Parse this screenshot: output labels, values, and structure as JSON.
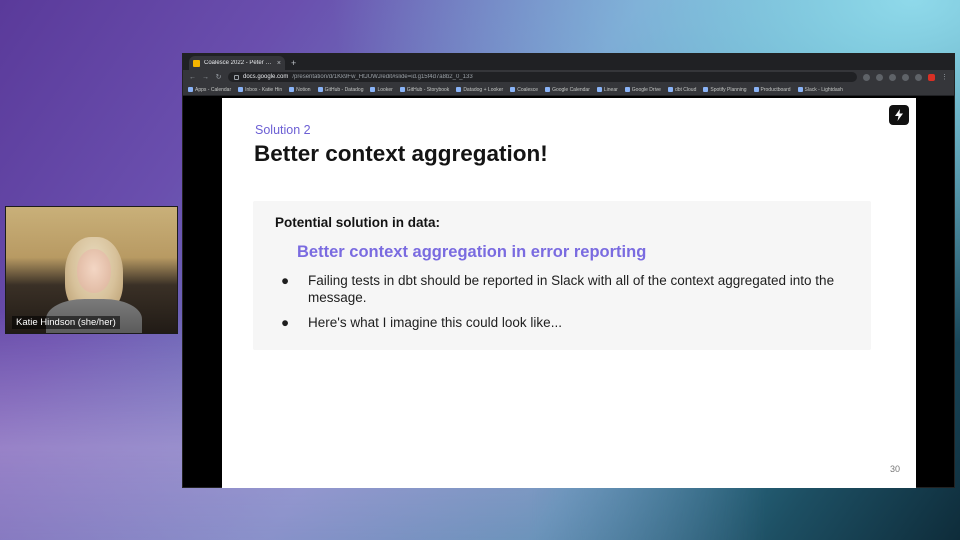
{
  "participant": {
    "name": "Katie Hindson (she/her)"
  },
  "browser": {
    "tab_title": "Coalesce 2022 - Peter Keen...",
    "tab_close": "×",
    "new_tab": "+",
    "url_host": "docs.google.com",
    "url_path": "/presentation/d/1Kk9Fw_HtJUWJ/edit#slide=id.g15f4d7a8b2_0_133",
    "bookmarks": [
      "Apps - Calendar",
      "Inbox - Katie Hin",
      "Notion",
      "GitHub - Datadog",
      "Looker",
      "GitHub - Storybook",
      "Datadog + Looker",
      "Coalesce",
      "Google Calendar",
      "Linear",
      "Google Drive",
      "dbt Cloud",
      "Spotify Planning",
      "Productboard",
      "Slack - Lightdash"
    ]
  },
  "slide": {
    "kicker": "Solution 2",
    "title": "Better context aggregation!",
    "callout_heading": "Potential solution in data:",
    "callout_subheading": "Better context aggregation in error reporting",
    "bullet_marker": "●",
    "bullets": [
      "Failing tests in dbt should be reported in Slack with all of the context aggregated into the message.",
      "Here's what I imagine this could look like..."
    ],
    "page_number": "30"
  },
  "colors": {
    "accent_purple": "#7a6be0",
    "kicker_purple": "#6c5fd4",
    "slide_bg": "#ffffff",
    "callout_bg": "#f6f6f6"
  }
}
